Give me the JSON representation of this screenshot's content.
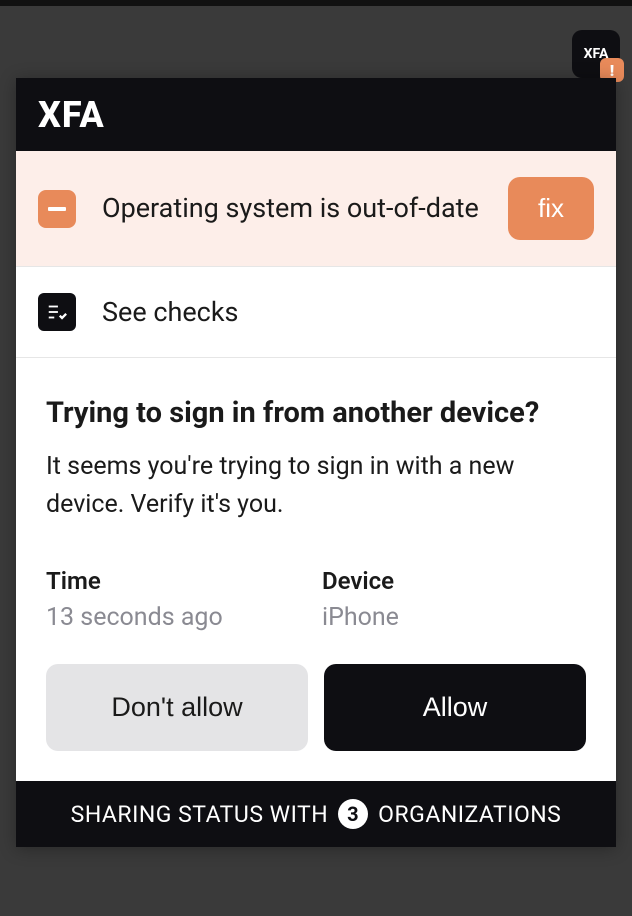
{
  "extension": {
    "label": "XFA",
    "alert": "!"
  },
  "header": {
    "logo": "XFA"
  },
  "alert": {
    "message": "Operating system is out-of-date",
    "fix_label": "fix"
  },
  "checks": {
    "label": "See checks"
  },
  "signin": {
    "title": "Trying to sign in from another device?",
    "subtitle": "It seems you're trying to sign in with a new device. Verify it's you.",
    "time_label": "Time",
    "time_value": "13 seconds ago",
    "device_label": "Device",
    "device_value": "iPhone",
    "deny_label": "Don't allow",
    "allow_label": "Allow"
  },
  "footer": {
    "prefix": "SHARING STATUS WITH",
    "count": "3",
    "suffix": "ORGANIZATIONS"
  }
}
